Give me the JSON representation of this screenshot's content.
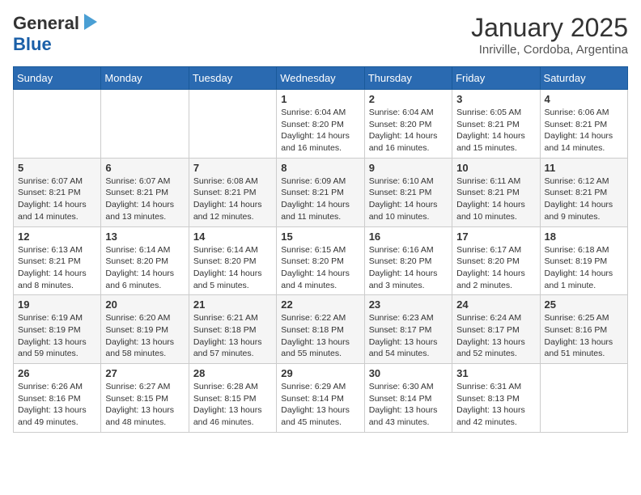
{
  "header": {
    "logo_general": "General",
    "logo_blue": "Blue",
    "month": "January 2025",
    "location": "Inriville, Cordoba, Argentina"
  },
  "weekdays": [
    "Sunday",
    "Monday",
    "Tuesday",
    "Wednesday",
    "Thursday",
    "Friday",
    "Saturday"
  ],
  "weeks": [
    [
      {
        "day": "",
        "info": ""
      },
      {
        "day": "",
        "info": ""
      },
      {
        "day": "",
        "info": ""
      },
      {
        "day": "1",
        "info": "Sunrise: 6:04 AM\nSunset: 8:20 PM\nDaylight: 14 hours\nand 16 minutes."
      },
      {
        "day": "2",
        "info": "Sunrise: 6:04 AM\nSunset: 8:20 PM\nDaylight: 14 hours\nand 16 minutes."
      },
      {
        "day": "3",
        "info": "Sunrise: 6:05 AM\nSunset: 8:21 PM\nDaylight: 14 hours\nand 15 minutes."
      },
      {
        "day": "4",
        "info": "Sunrise: 6:06 AM\nSunset: 8:21 PM\nDaylight: 14 hours\nand 14 minutes."
      }
    ],
    [
      {
        "day": "5",
        "info": "Sunrise: 6:07 AM\nSunset: 8:21 PM\nDaylight: 14 hours\nand 14 minutes."
      },
      {
        "day": "6",
        "info": "Sunrise: 6:07 AM\nSunset: 8:21 PM\nDaylight: 14 hours\nand 13 minutes."
      },
      {
        "day": "7",
        "info": "Sunrise: 6:08 AM\nSunset: 8:21 PM\nDaylight: 14 hours\nand 12 minutes."
      },
      {
        "day": "8",
        "info": "Sunrise: 6:09 AM\nSunset: 8:21 PM\nDaylight: 14 hours\nand 11 minutes."
      },
      {
        "day": "9",
        "info": "Sunrise: 6:10 AM\nSunset: 8:21 PM\nDaylight: 14 hours\nand 10 minutes."
      },
      {
        "day": "10",
        "info": "Sunrise: 6:11 AM\nSunset: 8:21 PM\nDaylight: 14 hours\nand 10 minutes."
      },
      {
        "day": "11",
        "info": "Sunrise: 6:12 AM\nSunset: 8:21 PM\nDaylight: 14 hours\nand 9 minutes."
      }
    ],
    [
      {
        "day": "12",
        "info": "Sunrise: 6:13 AM\nSunset: 8:21 PM\nDaylight: 14 hours\nand 8 minutes."
      },
      {
        "day": "13",
        "info": "Sunrise: 6:14 AM\nSunset: 8:20 PM\nDaylight: 14 hours\nand 6 minutes."
      },
      {
        "day": "14",
        "info": "Sunrise: 6:14 AM\nSunset: 8:20 PM\nDaylight: 14 hours\nand 5 minutes."
      },
      {
        "day": "15",
        "info": "Sunrise: 6:15 AM\nSunset: 8:20 PM\nDaylight: 14 hours\nand 4 minutes."
      },
      {
        "day": "16",
        "info": "Sunrise: 6:16 AM\nSunset: 8:20 PM\nDaylight: 14 hours\nand 3 minutes."
      },
      {
        "day": "17",
        "info": "Sunrise: 6:17 AM\nSunset: 8:20 PM\nDaylight: 14 hours\nand 2 minutes."
      },
      {
        "day": "18",
        "info": "Sunrise: 6:18 AM\nSunset: 8:19 PM\nDaylight: 14 hours\nand 1 minute."
      }
    ],
    [
      {
        "day": "19",
        "info": "Sunrise: 6:19 AM\nSunset: 8:19 PM\nDaylight: 13 hours\nand 59 minutes."
      },
      {
        "day": "20",
        "info": "Sunrise: 6:20 AM\nSunset: 8:19 PM\nDaylight: 13 hours\nand 58 minutes."
      },
      {
        "day": "21",
        "info": "Sunrise: 6:21 AM\nSunset: 8:18 PM\nDaylight: 13 hours\nand 57 minutes."
      },
      {
        "day": "22",
        "info": "Sunrise: 6:22 AM\nSunset: 8:18 PM\nDaylight: 13 hours\nand 55 minutes."
      },
      {
        "day": "23",
        "info": "Sunrise: 6:23 AM\nSunset: 8:17 PM\nDaylight: 13 hours\nand 54 minutes."
      },
      {
        "day": "24",
        "info": "Sunrise: 6:24 AM\nSunset: 8:17 PM\nDaylight: 13 hours\nand 52 minutes."
      },
      {
        "day": "25",
        "info": "Sunrise: 6:25 AM\nSunset: 8:16 PM\nDaylight: 13 hours\nand 51 minutes."
      }
    ],
    [
      {
        "day": "26",
        "info": "Sunrise: 6:26 AM\nSunset: 8:16 PM\nDaylight: 13 hours\nand 49 minutes."
      },
      {
        "day": "27",
        "info": "Sunrise: 6:27 AM\nSunset: 8:15 PM\nDaylight: 13 hours\nand 48 minutes."
      },
      {
        "day": "28",
        "info": "Sunrise: 6:28 AM\nSunset: 8:15 PM\nDaylight: 13 hours\nand 46 minutes."
      },
      {
        "day": "29",
        "info": "Sunrise: 6:29 AM\nSunset: 8:14 PM\nDaylight: 13 hours\nand 45 minutes."
      },
      {
        "day": "30",
        "info": "Sunrise: 6:30 AM\nSunset: 8:14 PM\nDaylight: 13 hours\nand 43 minutes."
      },
      {
        "day": "31",
        "info": "Sunrise: 6:31 AM\nSunset: 8:13 PM\nDaylight: 13 hours\nand 42 minutes."
      },
      {
        "day": "",
        "info": ""
      }
    ]
  ]
}
